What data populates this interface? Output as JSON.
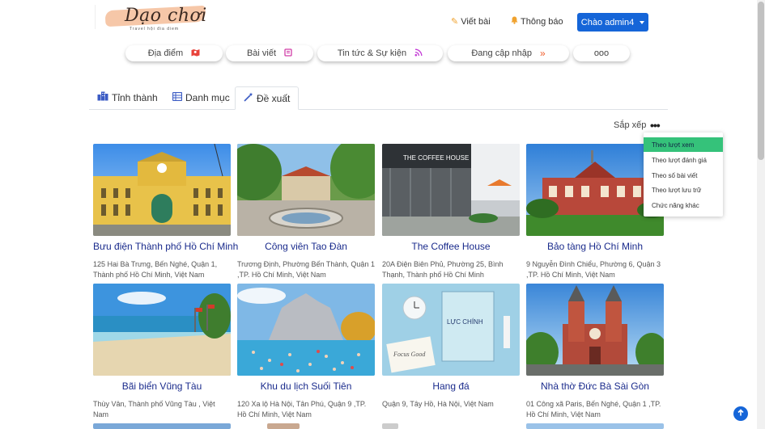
{
  "header": {
    "logo_text": "Dạo chơi",
    "logo_tagline": "Travel hội đia diem",
    "write_label": "Viết bài",
    "notify_label": "Thông báo",
    "user_label": "Chào admin4"
  },
  "nav": [
    {
      "label": "Địa điểm",
      "icon": "map-icon"
    },
    {
      "label": "Bài viết",
      "icon": "book-icon"
    },
    {
      "label": "Tin tức & Sự kiện",
      "icon": "rss-icon"
    },
    {
      "label": "Đang cập nhập",
      "icon": "double-chevron-icon"
    },
    {
      "label": "ooo",
      "icon": ""
    }
  ],
  "tabs": [
    {
      "label": "Tỉnh thành",
      "icon": "city-icon"
    },
    {
      "label": "Danh mục",
      "icon": "list-icon"
    },
    {
      "label": "Đề xuất",
      "icon": "magic-icon",
      "active": true
    }
  ],
  "sort": {
    "label": "Sắp xếp",
    "options": [
      "Theo lượt xem",
      "Theo lượt đánh giá",
      "Theo số bài viết",
      "Theo lượt lưu trữ",
      "Chức năng khác"
    ],
    "selected": "Theo lượt xem"
  },
  "cards": [
    {
      "title": "Bưu điện Thành phố Hồ Chí Minh",
      "address": "125 Hai Bà Trưng, Bến Nghé, Quận 1, Thành phố Hồ Chí Minh, Việt Nam"
    },
    {
      "title": "Công viên Tao Đàn",
      "address": "Trương Định, Phường Bến Thành, Quận 1 ,TP. Hồ Chí Minh, Việt Nam"
    },
    {
      "title": "The Coffee House",
      "address": "20A Điện Biên Phủ, Phường 25, Bình Thạnh, Thành phố Hồ Chí Minh"
    },
    {
      "title": "Bảo tàng Hồ Chí Minh",
      "address": "9 Nguyễn Đình Chiểu, Phường 6, Quận 3 ,TP. Hồ Chí Minh, Việt Nam"
    },
    {
      "title": "Bãi biển Vũng Tàu",
      "address": "Thùy Vân, Thành phố Vũng Tàu , Việt Nam"
    },
    {
      "title": "Khu du lịch Suối Tiên",
      "address": "120 Xa lộ Hà Nội, Tân Phú, Quận 9 ,TP. Hồ Chí Minh, Việt Nam"
    },
    {
      "title": "Hang đá",
      "address": "Quận 9, Tây Hồ, Hà Nội, Việt Nam"
    },
    {
      "title": "Nhà thờ Đức Bà Sài Gòn",
      "address": "01 Công xã Paris, Bến Nghé, Quận 1 ,TP. Hồ Chí Minh, Việt Nam"
    }
  ],
  "image_texts": {
    "coffee_sign": "THE COFFEE HOUSE",
    "book_title": "LỰC CHÍNH",
    "book_note": "Focus Good"
  },
  "colors": {
    "primary": "#1565d8",
    "title": "#1a2b8c",
    "sort_active": "#35c27a",
    "icon_accent": "#f0a22e"
  }
}
